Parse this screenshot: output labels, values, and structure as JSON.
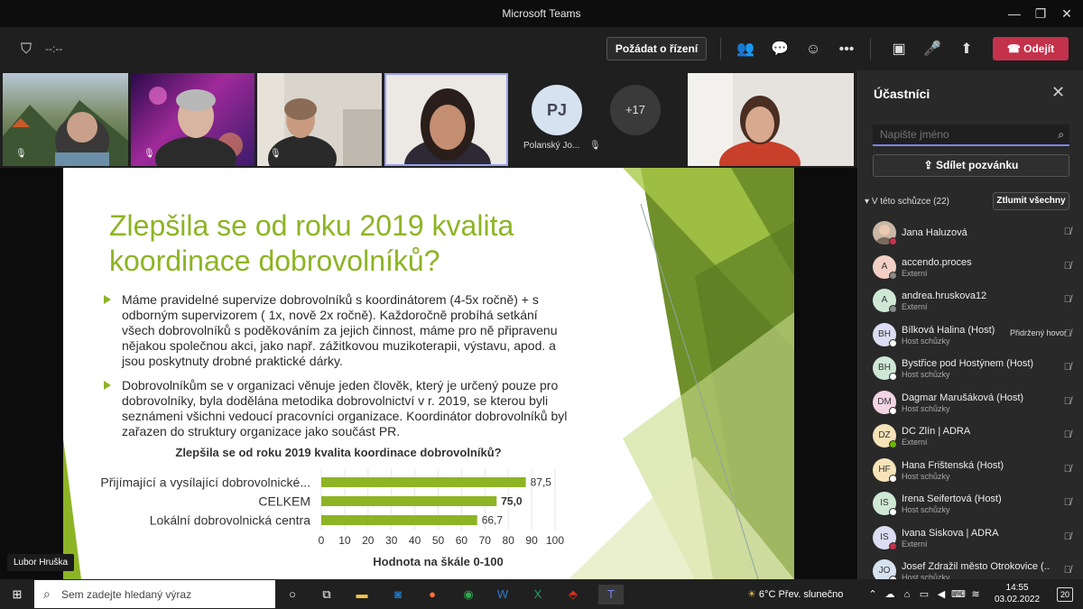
{
  "window": {
    "title": "Microsoft Teams",
    "minimize": "—",
    "restore": "❐",
    "close": "✕"
  },
  "toolbar": {
    "timer": "--:--",
    "request_control": "Požádat o řízení",
    "leave": "Odejít",
    "icons": {
      "shield": "⛉",
      "participants": "👥",
      "chat": "💬",
      "reactions": "☺",
      "more": "•••",
      "camera": "▣",
      "mic": "🎤",
      "share": "⬆",
      "phone": "☎"
    }
  },
  "strip": {
    "pj_initials": "PJ",
    "pj_name": "Polanský Jo...",
    "more_count": "+17",
    "mic_glyph": "🎙"
  },
  "slide": {
    "title": "Zlepšila se od roku 2019 kvalita koordinace dobrovolníků?",
    "bullets": [
      "Máme pravidelné supervize dobrovolníků s koordinátorem (4-5x ročně) + s odborným supervizorem ( 1x, nově 2x ročně). Každoročně probíhá setkání všech dobrovolníků s poděkováním za jejich činnost, máme pro ně připravenu nějakou společnou akci, jako např. zážitkovou muzikoterapii, výstavu, apod. a jsou poskytnuty drobné praktické dárky.",
      "Dobrovolníkům se v organizaci věnuje jeden člověk, který je určený pouze pro dobrovolníky, byla dodělána metodika dobrovolnictví v r. 2019, se kterou byli seznámeni všichni vedoucí pracovníci organizace. Koordinátor dobrovolníků byl zařazen do struktury organizace jako součást PR."
    ],
    "presenter": "Lubor Hruška",
    "accent": "#8db424"
  },
  "chart_data": {
    "type": "bar",
    "orientation": "horizontal",
    "title": "Zlepšila se od roku 2019 kvalita koordinace dobrovolníků?",
    "xlabel": "Hodnota na škále 0-100",
    "categories": [
      "Přijímající a vysílající dobrovolnické...",
      "CELKEM",
      "Lokální dobrovolnická centra"
    ],
    "values": [
      87.5,
      75.0,
      66.7
    ],
    "value_labels": [
      "87,5",
      "75,0",
      "66,7"
    ],
    "xlim": [
      0,
      100
    ],
    "xticks": [
      "0",
      "10",
      "20",
      "30",
      "40",
      "50",
      "60",
      "70",
      "80",
      "90",
      "100"
    ],
    "bar_color": "#8db424"
  },
  "panel": {
    "title": "Účastníci",
    "search_placeholder": "Napište jméno",
    "invite": "Sdílet pozvánku",
    "section": "V této schůzce (22)",
    "mute_all": "Ztlumit všechny",
    "participants": [
      {
        "initials": "",
        "name": "Jana Haluzová",
        "sub": "",
        "bg": "#c9b7a6",
        "status": "#c4314b",
        "extra": ""
      },
      {
        "initials": "A",
        "name": "accendo.proces",
        "sub": "Externí",
        "bg": "#f4cfc4",
        "status": "#888888",
        "extra": ""
      },
      {
        "initials": "A",
        "name": "andrea.hruskova12",
        "sub": "Externí",
        "bg": "#cfe8d5",
        "status": "#888888",
        "extra": ""
      },
      {
        "initials": "BH",
        "name": "Bílková Halina (Host)",
        "sub": "Host schůzky",
        "bg": "#dcdcf2",
        "status": "#ffffff",
        "extra": "Přidržený hovor"
      },
      {
        "initials": "BH",
        "name": "Bystřice pod Hostýnem (Host)",
        "sub": "Host schůzky",
        "bg": "#cfe8d5",
        "status": "#ffffff",
        "extra": ""
      },
      {
        "initials": "DM",
        "name": "Dagmar Marušáková (Host)",
        "sub": "Host schůzky",
        "bg": "#f2d4e4",
        "status": "#ffffff",
        "extra": ""
      },
      {
        "initials": "DZ",
        "name": "DC Zlín | ADRA",
        "sub": "Externí",
        "bg": "#f6e3b8",
        "status": "#6bb700",
        "extra": ""
      },
      {
        "initials": "HF",
        "name": "Hana Frištenská (Host)",
        "sub": "Host schůzky",
        "bg": "#f6e3b8",
        "status": "#ffffff",
        "extra": ""
      },
      {
        "initials": "IS",
        "name": "Irena Seifertová (Host)",
        "sub": "Host schůzky",
        "bg": "#cfe8d5",
        "status": "#ffffff",
        "extra": ""
      },
      {
        "initials": "IS",
        "name": "Ivana Siskova | ADRA",
        "sub": "Externí",
        "bg": "#dcdcf2",
        "status": "#c4314b",
        "extra": ""
      },
      {
        "initials": "JO",
        "name": "Josef Zdražil město Otrokovice (...",
        "sub": "Host schůzky",
        "bg": "#d6e2ef",
        "status": "#ffffff",
        "extra": ""
      }
    ]
  },
  "taskbar": {
    "search_text": "Sem zadejte hledaný výraz",
    "weather": "6°C  Přev. slunečno",
    "time": "14:55",
    "date": "03.02.2022",
    "notifications": "20"
  }
}
